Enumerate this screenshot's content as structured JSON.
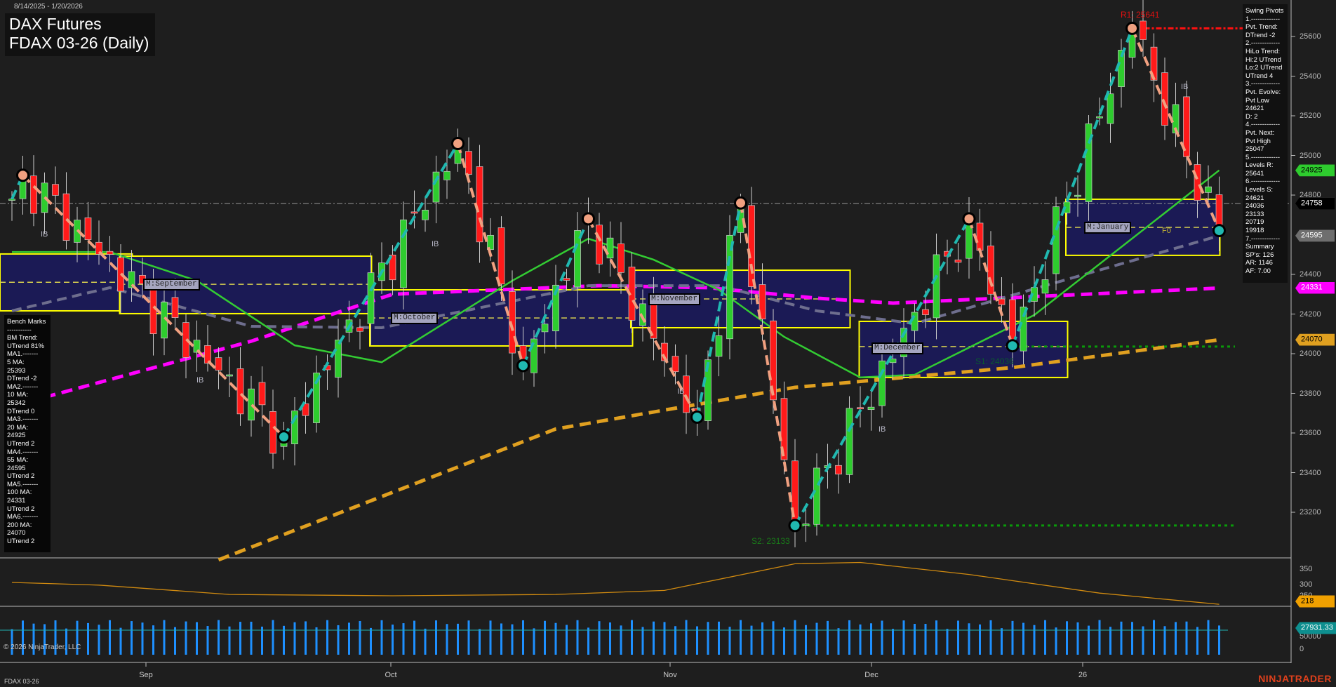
{
  "header": {
    "date_range": "8/14/2025 - 1/20/2026",
    "title_line1": "DAX Futures",
    "title_line2": "FDAX 03-26 (Daily)"
  },
  "bench_marks": [
    "Bench Marks",
    "-----------",
    "BM Trend:",
    "UTrend 81%",
    "MA1.-------",
    "5 MA:",
    "25393",
    "DTrend -2",
    "MA2.-------",
    "10 MA:",
    "25342",
    "DTrend 0",
    "MA3.-------",
    "20 MA:",
    "24925",
    "UTrend 2",
    "MA4.-------",
    "55 MA:",
    "24595",
    "UTrend 2",
    "MA5.-------",
    "100 MA:",
    "24331",
    "UTrend 2",
    "MA6.-------",
    "200 MA:",
    "24070",
    "UTrend 2"
  ],
  "swing_pivots": [
    "Swing Pivots",
    "1.-------------",
    "Pvt. Trend:",
    "DTrend -2",
    "2.-------------",
    "HiLo Trend:",
    "Hi:2 UTrend",
    "Lo:2 UTrend",
    "UTrend 4",
    "3.-------------",
    "Pvt. Evolve:",
    "Pvt Low",
    "24621",
    "D: 2",
    "4.-------------",
    "Pvt. Next:",
    "Pvt High",
    "25047",
    "5.-------------",
    "Levels R:",
    "25641",
    "6.-------------",
    "Levels S:",
    "24621",
    "24036",
    "23133",
    "20719",
    "19918",
    "7.-------------",
    "Summary",
    "SP's: 126",
    "AR: 1146",
    "AF: 7.00"
  ],
  "price_axis": [
    "25600",
    "25400",
    "25200",
    "25000",
    "24800",
    "24400",
    "24200",
    "24000",
    "23800",
    "23600",
    "23400",
    "23200"
  ],
  "badges": [
    {
      "label": "24925",
      "color": "#2ecc2e",
      "text": "#000"
    },
    {
      "label": "24758",
      "color": "#000000",
      "text": "#fff"
    },
    {
      "label": "24595",
      "color": "#6e6e6e",
      "text": "#fff"
    },
    {
      "label": "24331",
      "color": "#ff00ff",
      "text": "#fff"
    },
    {
      "label": "24070",
      "color": "#e0a020",
      "text": "#000"
    }
  ],
  "indicator_axis": [
    "350",
    "300",
    "250"
  ],
  "indicator_value": "218",
  "volume_axis": [
    "50000",
    "0"
  ],
  "volume_value": "27931.33",
  "x_axis": [
    "Sep",
    "Oct",
    "Nov",
    "Dec",
    "26"
  ],
  "months": [
    "M:September",
    "M:October",
    "M:November",
    "M:December",
    "M:January"
  ],
  "levels": {
    "r1": "R1: 25641",
    "s1": "S1: 24036",
    "s2": "S2: 23133",
    "f0": "F0"
  },
  "ib_label": "IB",
  "copyright": "© 2026 NinjaTrader, LLC",
  "footer_instrument": "FDAX 03-26",
  "brand": "NINJATRADER",
  "chart_data": {
    "type": "candlestick",
    "instrument": "FDAX 03-26",
    "bars": 112,
    "ylim": [
      23000,
      25700
    ],
    "last_price": 24758,
    "swing_pivots": [
      [
        0,
        24780
      ],
      [
        1,
        24900
      ],
      [
        25,
        23580
      ],
      [
        41,
        25060
      ],
      [
        47,
        23940
      ],
      [
        53,
        24680
      ],
      [
        63,
        23680
      ],
      [
        67,
        24760
      ],
      [
        72,
        23133
      ],
      [
        88,
        24680
      ],
      [
        92,
        24040
      ],
      [
        103,
        25641
      ],
      [
        111,
        24621
      ]
    ],
    "ma20": [
      [
        0,
        24513
      ],
      [
        9,
        24513
      ],
      [
        17,
        24368
      ],
      [
        26,
        24042
      ],
      [
        34,
        23957
      ],
      [
        46,
        24368
      ],
      [
        53,
        24580
      ],
      [
        59,
        24474
      ],
      [
        65,
        24322
      ],
      [
        71,
        24085
      ],
      [
        78,
        23880
      ],
      [
        83,
        23894
      ],
      [
        94,
        24195
      ],
      [
        102,
        24538
      ],
      [
        111,
        24925
      ]
    ],
    "ma55": [
      [
        0,
        24216
      ],
      [
        9,
        24333
      ],
      [
        22,
        24138
      ],
      [
        34,
        24131
      ],
      [
        53,
        24343
      ],
      [
        65,
        24343
      ],
      [
        74,
        24216
      ],
      [
        83,
        24152
      ],
      [
        95,
        24343
      ],
      [
        111,
        24595
      ]
    ],
    "ma100": [
      [
        3,
        23780
      ],
      [
        22,
        24063
      ],
      [
        35,
        24300
      ],
      [
        54,
        24343
      ],
      [
        64,
        24333
      ],
      [
        74,
        24280
      ],
      [
        81,
        24255
      ],
      [
        111,
        24331
      ]
    ],
    "ma200": [
      [
        19,
        22960
      ],
      [
        50,
        23620
      ],
      [
        72,
        23830
      ],
      [
        92,
        23930
      ],
      [
        111,
        24070
      ]
    ],
    "month_boxes": [
      {
        "from": 0,
        "to": 11,
        "top": 24503,
        "bottom": 24216,
        "mid": 24360
      },
      {
        "from": 11,
        "to": 33,
        "top": 24492,
        "bottom": 24202,
        "mid": 24350
      },
      {
        "from": 34,
        "to": 57,
        "top": 24322,
        "bottom": 24039,
        "mid": 24180
      },
      {
        "from": 58,
        "to": 77,
        "top": 24421,
        "bottom": 24131,
        "mid": 24276
      },
      {
        "from": 79,
        "to": 97,
        "top": 24163,
        "bottom": 23880,
        "mid": 24036
      },
      {
        "from": 98,
        "to": 111,
        "top": 24779,
        "bottom": 24496,
        "mid": 24637
      }
    ],
    "resistance": {
      "price": 25641,
      "from": 103
    },
    "supports": [
      {
        "price": 24036,
        "from": 92
      },
      {
        "price": 23133,
        "from": 72
      }
    ],
    "indicator": [
      [
        0,
        300
      ],
      [
        8,
        290
      ],
      [
        20,
        255
      ],
      [
        35,
        250
      ],
      [
        50,
        255
      ],
      [
        60,
        270
      ],
      [
        72,
        370
      ],
      [
        78,
        375
      ],
      [
        88,
        330
      ],
      [
        100,
        260
      ],
      [
        111,
        218
      ]
    ],
    "volume_scale_max": 50000
  }
}
